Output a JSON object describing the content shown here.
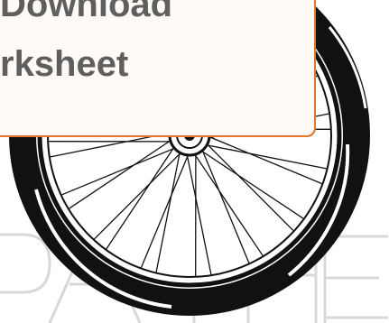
{
  "card": {
    "line1": "Download",
    "line2": "rksheet"
  },
  "colors": {
    "card_border": "#e8732b",
    "card_bg": "#fffaf5",
    "text": "#5f5f5f",
    "tire": "#111111",
    "spokes": "#111111",
    "watermark": "#d8d8d8"
  },
  "icons": {
    "wheel": "bicycle-wheel-illustration",
    "watermark": "path-watermark"
  }
}
